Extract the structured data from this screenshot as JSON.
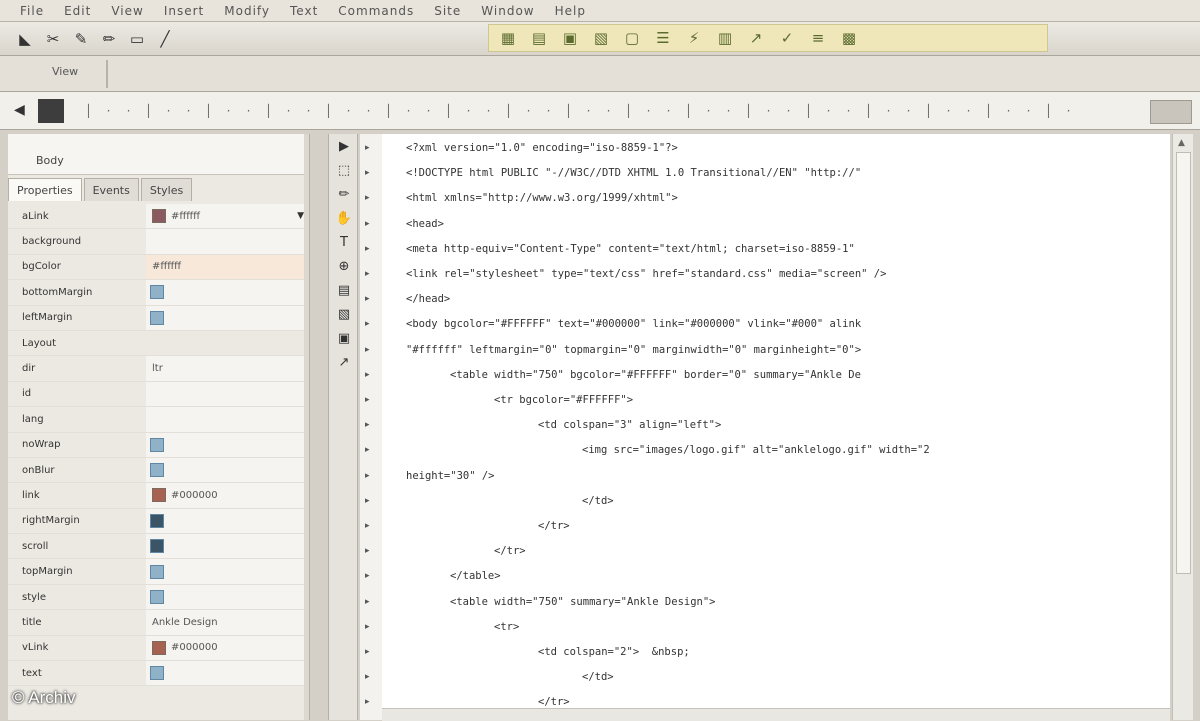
{
  "menubar": {
    "items": [
      "File",
      "Edit",
      "View",
      "Insert",
      "Modify",
      "Text",
      "Commands",
      "Site",
      "Window",
      "Help"
    ]
  },
  "toolbar": {
    "left_icons": [
      "open-icon",
      "crop-icon",
      "brush-icon",
      "pencil-icon",
      "eraser-icon",
      "line-icon"
    ],
    "right_icons": [
      "grid-icon",
      "table-icon",
      "image-icon",
      "layer-icon",
      "frame-icon",
      "list-icon",
      "flash-icon",
      "form-icon",
      "link-icon",
      "check-icon",
      "code-icon",
      "edit-icon"
    ]
  },
  "toolbar2": {
    "label": "View"
  },
  "panel": {
    "header_label": "Body",
    "tabs": [
      "Properties",
      "Events",
      "Styles"
    ],
    "properties": [
      {
        "name": "aLink",
        "kind": "color",
        "value": "#ffffff"
      },
      {
        "name": "background",
        "kind": "text",
        "value": ""
      },
      {
        "name": "bgColor",
        "kind": "text",
        "value": "#ffffff"
      },
      {
        "name": "bottomMargin",
        "kind": "check"
      },
      {
        "name": "leftMargin",
        "kind": "check"
      },
      {
        "name": "Layout",
        "kind": "section"
      },
      {
        "name": "dir",
        "kind": "text",
        "value": "ltr"
      },
      {
        "name": "id",
        "kind": "text",
        "value": ""
      },
      {
        "name": "lang",
        "kind": "text",
        "value": ""
      },
      {
        "name": "noWrap",
        "kind": "check"
      },
      {
        "name": "onBlur",
        "kind": "check"
      },
      {
        "name": "link",
        "kind": "color",
        "value": "#000000"
      },
      {
        "name": "rightMargin",
        "kind": "check-dark"
      },
      {
        "name": "scroll",
        "kind": "check-dark"
      },
      {
        "name": "topMargin",
        "kind": "check"
      },
      {
        "name": "style",
        "kind": "check"
      },
      {
        "name": "title",
        "kind": "text",
        "value": "Ankle Design"
      },
      {
        "name": "vLink",
        "kind": "color",
        "value": "#000000"
      },
      {
        "name": "text",
        "kind": "check"
      }
    ]
  },
  "gutter_tools": [
    "pointer-icon",
    "select-icon",
    "pencil-icon",
    "hand-icon",
    "text-icon",
    "zoom-icon",
    "table-icon",
    "layer-icon",
    "image-icon",
    "link-icon"
  ],
  "editor": {
    "lines": [
      {
        "indent": 0,
        "text": "<?xml version=\"1.0\" encoding=\"iso-8859-1\"?>"
      },
      {
        "indent": 0,
        "text": "<!DOCTYPE html PUBLIC \"-//W3C//DTD XHTML 1.0 Transitional//EN\" \"http://\""
      },
      {
        "indent": 0,
        "text": "<html xmlns=\"http://www.w3.org/1999/xhtml\">"
      },
      {
        "indent": 0,
        "text": "<head>"
      },
      {
        "indent": 0,
        "text": "<meta http-equiv=\"Content-Type\" content=\"text/html; charset=iso-8859-1\""
      },
      {
        "indent": 0,
        "text": "<link rel=\"stylesheet\" type=\"text/css\" href=\"standard.css\" media=\"screen\" />"
      },
      {
        "indent": 0,
        "text": "</head>"
      },
      {
        "indent": 0,
        "text": "<body bgcolor=\"#FFFFFF\" text=\"#000000\" link=\"#000000\" vlink=\"#000\" alink"
      },
      {
        "indent": 0,
        "text": "\"#ffffff\" leftmargin=\"0\" topmargin=\"0\" marginwidth=\"0\" marginheight=\"0\">"
      },
      {
        "indent": 1,
        "text": "<table width=\"750\" bgcolor=\"#FFFFFF\" border=\"0\" summary=\"Ankle De"
      },
      {
        "indent": 2,
        "text": "<tr bgcolor=\"#FFFFFF\">"
      },
      {
        "indent": 3,
        "text": "<td colspan=\"3\" align=\"left\">"
      },
      {
        "indent": 4,
        "text": "<img src=\"images/logo.gif\" alt=\"anklelogo.gif\" width=\"2"
      },
      {
        "indent": 0,
        "text": "height=\"30\" />"
      },
      {
        "indent": 4,
        "text": "</td>"
      },
      {
        "indent": 3,
        "text": "</tr>"
      },
      {
        "indent": 2,
        "text": "</tr>"
      },
      {
        "indent": 1,
        "text": "</table>"
      },
      {
        "indent": 1,
        "text": "<table width=\"750\" summary=\"Ankle Design\">"
      },
      {
        "indent": 2,
        "text": "<tr>"
      },
      {
        "indent": 3,
        "text": "<td colspan=\"2\">  &nbsp;"
      },
      {
        "indent": 4,
        "text": "</td>"
      },
      {
        "indent": 3,
        "text": "</tr>"
      }
    ]
  },
  "watermark": "© Archiv"
}
